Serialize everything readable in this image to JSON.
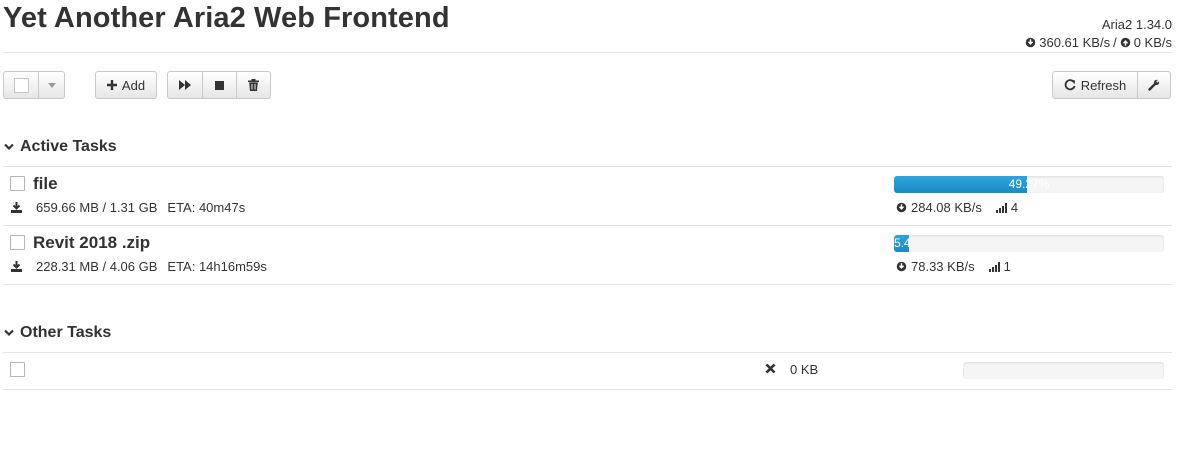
{
  "app": {
    "title": "Yet Another Aria2 Web Frontend",
    "version": "Aria2 1.34.0",
    "download_speed": "360.61 KB/s",
    "separator": "/",
    "upload_speed": "0 KB/s"
  },
  "toolbar": {
    "add_label": "Add",
    "refresh_label": "Refresh"
  },
  "sections": {
    "active_title": "Active Tasks",
    "other_title": "Other Tasks"
  },
  "active_tasks": [
    {
      "name": "file",
      "size": "659.66 MB / 1.31 GB",
      "eta": "ETA: 40m47s",
      "progress_percent": 49.27,
      "progress_label": "49.27%",
      "speed": "284.08 KB/s",
      "connections": "4"
    },
    {
      "name": "Revit 2018 .zip",
      "size": "228.31 MB / 4.06 GB",
      "eta": "ETA: 14h16m59s",
      "progress_percent": 5.4,
      "progress_label": "5.4",
      "speed": "78.33 KB/s",
      "connections": "1"
    }
  ],
  "other_tasks": [
    {
      "name": "",
      "size": "0 KB",
      "progress_percent": 0,
      "progress_label": ""
    }
  ],
  "colors": {
    "progress_bar": "#2a9fd6",
    "text": "#333333"
  }
}
